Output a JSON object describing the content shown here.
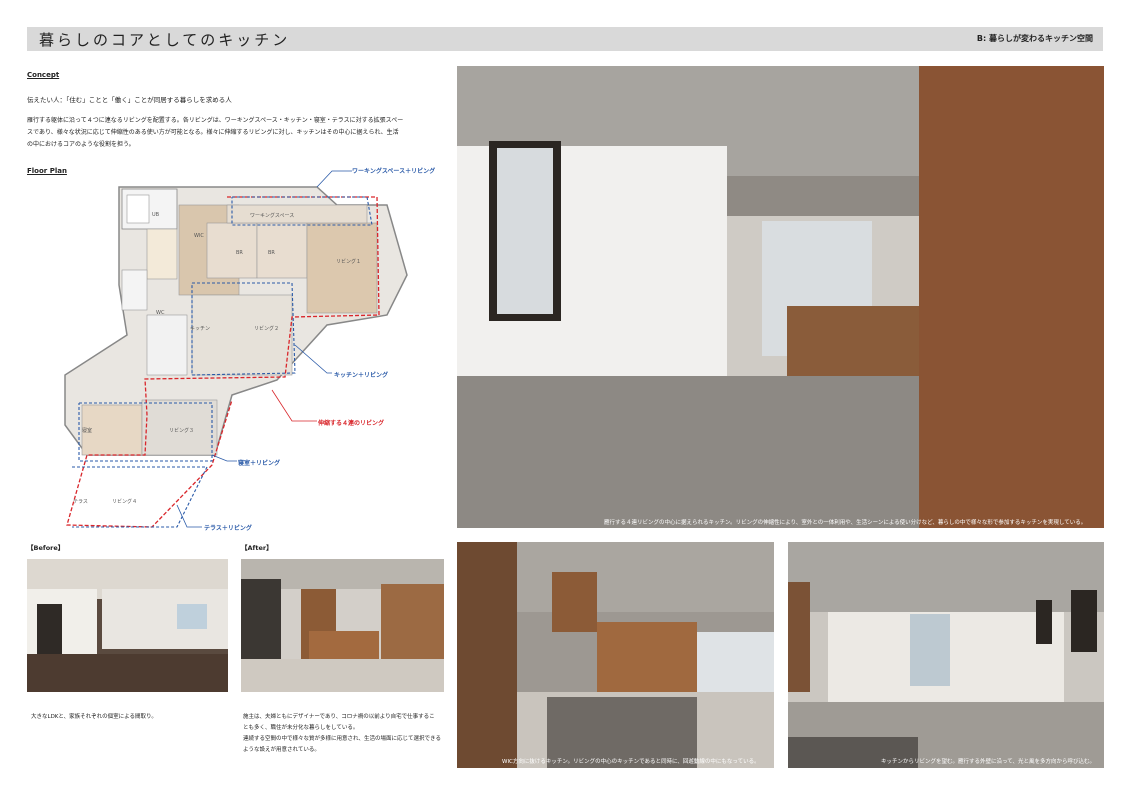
{
  "header": {
    "title": "暮らしのコアとしてのキッチン",
    "subtitle": "B: 暮らしが変わるキッチン空間"
  },
  "concept": {
    "heading": "Concept",
    "lead": "伝えたい人：「住む」ことと「働く」ことが同居する暮らしを求める人",
    "body_lines": [
      "雁行する躯体に沿って４つに連なるリビングを配置する。各リビングは、ワーキングスペース・キッチン・寝室・テラスに対する拡張スペー",
      "スであり、様々な状況に応じて伸縮性のある使い方が可能となる。様々に伸縮するリビングに対し、キッチンはその中心に据えられ、生活",
      "の中におけるコアのような役割を担う。"
    ]
  },
  "floor_plan": {
    "heading": "Floor Plan",
    "labels": {
      "working": "ワーキングスペース＋リビング",
      "kitchen": "キッチン＋リビング",
      "four_living": "伸縮する４連のリビング",
      "bedroom": "寝室＋リビング",
      "terrace": "テラス＋リビング"
    },
    "rooms": {
      "working_space": "ワーキングスペース",
      "living1": "リビング１",
      "living2": "リビング２",
      "living3": "リビング３",
      "living4": "リビング４",
      "terrace": "テラス",
      "kitchen": "キッチン",
      "bedroom": "寝室",
      "br1": "BR",
      "br2": "BR",
      "wic": "WIC",
      "ub": "UB",
      "wc": "WC"
    },
    "colors": {
      "red": "#d9262b",
      "blue": "#2a5aa8"
    }
  },
  "before_after": {
    "before_heading": "【Before】",
    "after_heading": "【After】",
    "before_text": "大きなLDKと、家族それぞれの個室による間取り。",
    "after_lines": [
      "施主は、夫婦ともにデザイナーであり、コロナ禍の以前より自宅で仕事するこ",
      "とも多く、職住が未分化な暮らしをしている。",
      "連続する空間の中で様々な質が多様に用意され、生活の場面に応じて選択できる",
      "ような設えが用意されている。"
    ]
  },
  "captions": {
    "main": "雁行する４連リビングの中心に据えられるキッチン。リビングの伸縮性により、室外との一体利用や、生活シーンによる使い分けなど、暮らしの中で様々な形で参加するキッチンを実現している。",
    "bottom_left": "WIC方向に抜けるキッチン。リビングの中心のキッチンであると同時に、回遊動線の中にもなっている。",
    "bottom_right": "キッチンからリビングを望む。雁行する外壁に沿って、光と風を多方向から呼び込む。"
  }
}
